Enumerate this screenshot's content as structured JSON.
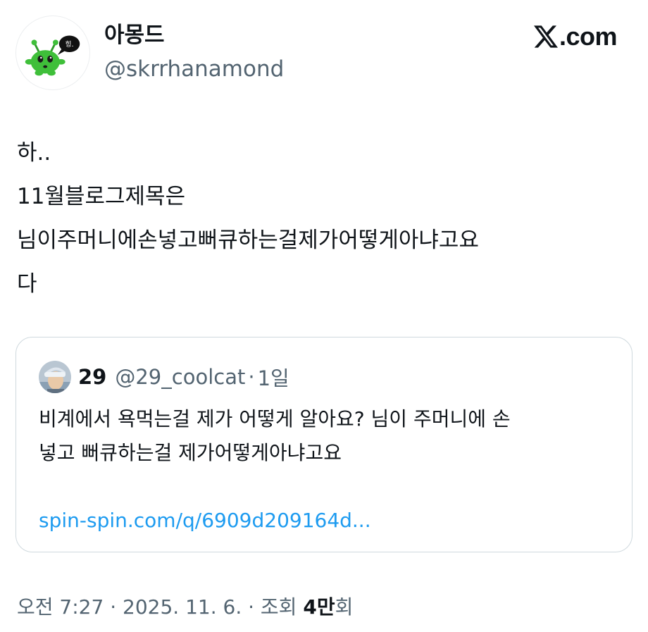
{
  "author": {
    "display_name": "아몽드",
    "handle": "@skrrhanamond",
    "avatar_icon": "green-alien-speech-bubble-icon",
    "avatar_bubble_text": "힝."
  },
  "brand": {
    "label": ".com",
    "icon": "x-logo-icon"
  },
  "tweet": {
    "lines": [
      "하..",
      "11월블로그제목은",
      "님이주머니에손넣고뻐큐하는걸제가어떻게아냐고요",
      "다"
    ]
  },
  "quote": {
    "display_name": "29",
    "handle": "@29_coolcat",
    "separator": "·",
    "time": "1일",
    "avatar_icon": "profile-photo-icon",
    "lines": [
      "비계에서 욕먹는걸 제가 어떻게 알아요? 님이 주머니에 손",
      "넣고 뻐큐하는걸 제가어떻게아냐고요"
    ],
    "link": "spin-spin.com/q/6909d209164d..."
  },
  "meta": {
    "time": "오전 7:27",
    "separator": " · ",
    "date": "2025. 11. 6.",
    "views_label": "조회 ",
    "views_count": "4만",
    "views_suffix": "회"
  },
  "colors": {
    "text_primary": "#0f1419",
    "text_secondary": "#536471",
    "link": "#1d9bf0",
    "border": "#cfd9de",
    "avatar_green": "#3fbf3a"
  }
}
